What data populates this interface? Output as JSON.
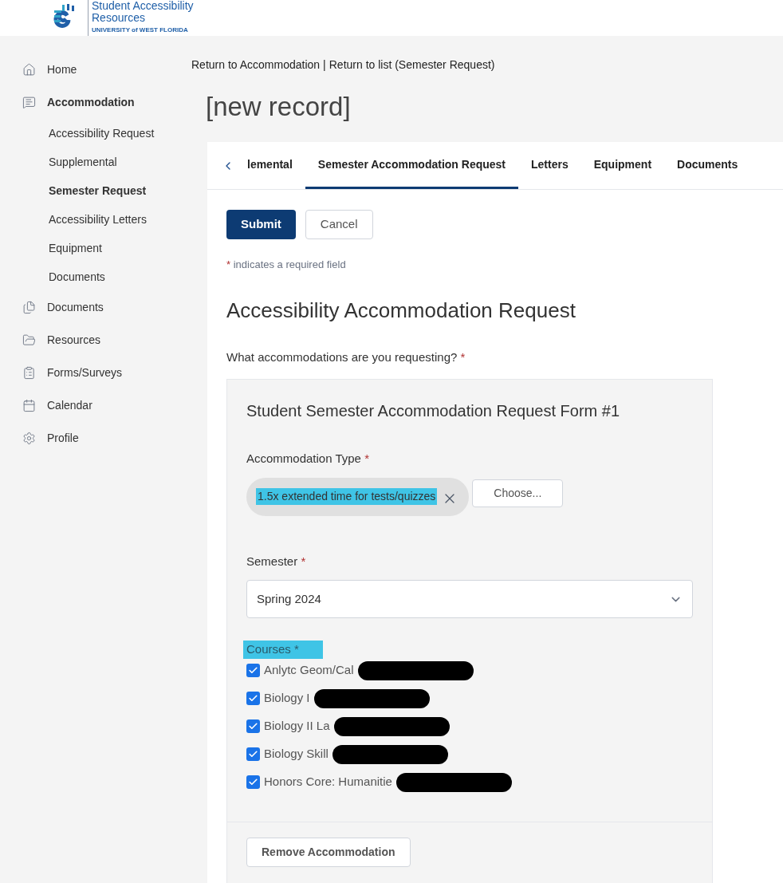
{
  "logo": {
    "title": "Student Accessibility",
    "subtitle": "Resources",
    "university": "UNIVERSITY of WEST FLORIDA"
  },
  "sidebar": {
    "items": [
      {
        "label": "Home",
        "selected": false
      },
      {
        "label": "Accommodation",
        "selected": true,
        "children": [
          {
            "label": "Accessibility Request",
            "selected": false
          },
          {
            "label": "Supplemental",
            "selected": false
          },
          {
            "label": "Semester Request",
            "selected": true
          },
          {
            "label": "Accessibility Letters",
            "selected": false
          },
          {
            "label": "Equipment",
            "selected": false
          },
          {
            "label": "Documents",
            "selected": false
          }
        ]
      },
      {
        "label": "Documents",
        "selected": false
      },
      {
        "label": "Resources",
        "selected": false
      },
      {
        "label": "Forms/Surveys",
        "selected": false
      },
      {
        "label": "Calendar",
        "selected": false
      },
      {
        "label": "Profile",
        "selected": false
      }
    ]
  },
  "breadcrumb": [
    "Return to Accommodation",
    "Return to list (Semester Request)"
  ],
  "breadcrumb_separator": "|",
  "page_title": "[new record]",
  "tabs": [
    {
      "label": "lemental",
      "selected": false
    },
    {
      "label": "Semester Accommodation Request",
      "selected": true
    },
    {
      "label": "Letters",
      "selected": false
    },
    {
      "label": "Equipment",
      "selected": false
    },
    {
      "label": "Documents",
      "selected": false
    }
  ],
  "actions": [
    {
      "label": "Submit",
      "kind": "primary"
    },
    {
      "label": "Cancel",
      "kind": "secondary"
    }
  ],
  "required_note": {
    "mark": "*",
    "text": "indicates a required field"
  },
  "form_title": "Accessibility Accommodation Request",
  "question": {
    "label": "What accommodations are you requesting?",
    "mark": "*"
  },
  "request_form": {
    "title": "Student Semester Accommodation Request Form #1",
    "accommodation_type": {
      "label": "Accommodation Type",
      "mark": "*",
      "chip": {
        "label": "1.5x extended time for tests/quizzes",
        "highlighted": true
      },
      "choose_button": "Choose..."
    },
    "semester": {
      "label": "Semester",
      "mark": "*",
      "value": "Spring 2024"
    },
    "courses": {
      "label": "Courses *",
      "highlighted": true,
      "items": [
        {
          "label": "Anlytc Geom/Cal",
          "checked": true,
          "redacted": true
        },
        {
          "label": "Biology I",
          "checked": true,
          "redacted": true
        },
        {
          "label": "Biology II La",
          "checked": true,
          "redacted": true
        },
        {
          "label": "Biology Skill",
          "checked": true,
          "redacted": true
        },
        {
          "label": "Honors Core: Humanitie",
          "checked": true,
          "redacted": true
        }
      ]
    },
    "remove_button": "Remove Accommodation"
  }
}
